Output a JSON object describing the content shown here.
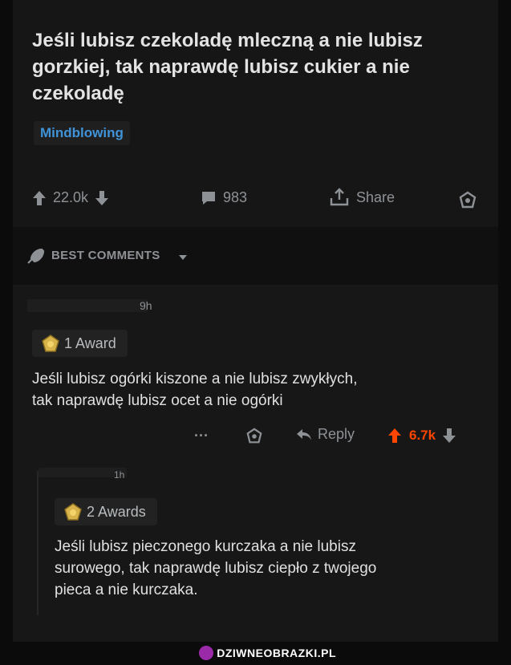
{
  "post": {
    "title": "Jeśli lubisz czekoladę mleczną a nie lubisz gorzkiej, tak naprawdę lubisz cukier a nie czekoladę",
    "flair": "Mindblowing",
    "score": "22.0k",
    "comments": "983",
    "share_label": "Share"
  },
  "sort": {
    "label": "BEST COMMENTS"
  },
  "comment1": {
    "age": "9h",
    "award": "1 Award",
    "text_line1": "Jeśli lubisz ogórki kiszone a nie lubisz zwykłych,",
    "text_line2": "tak naprawdę lubisz ocet a nie ogórki",
    "more": "···",
    "reply_label": "Reply",
    "score": "6.7k"
  },
  "comment2": {
    "age": "1h",
    "award": "2 Awards",
    "text_line1": "Jeśli lubisz pieczonego kurczaka a nie lubisz",
    "text_line2": "surowego, tak naprawdę lubisz ciepło z twojego",
    "text_line3": "pieca a nie kurczaka."
  },
  "watermark": "DZIWNEOBRAZKI.PL",
  "colors": {
    "accent_blue": "#3f93d8",
    "upvote_orange": "#ff4500",
    "muted": "#8e9296"
  }
}
